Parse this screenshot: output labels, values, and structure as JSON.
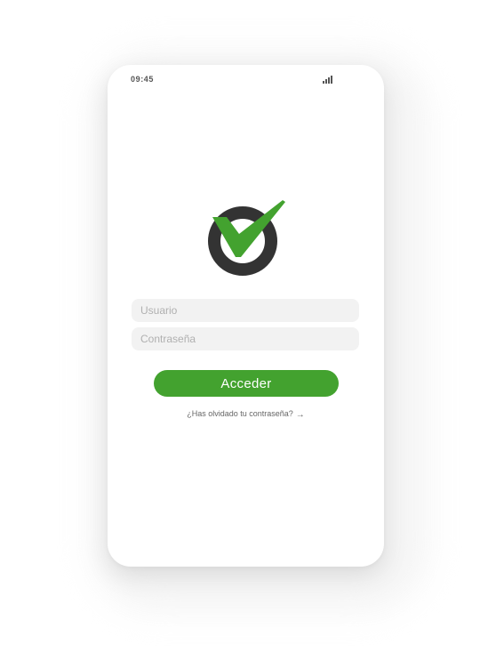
{
  "status_bar": {
    "time": "09:45",
    "signal_icon": "signal-bars-icon"
  },
  "logo": {
    "icon": "checkmark-circle-logo",
    "ring_color": "#333333",
    "check_color": "#43a22f"
  },
  "login_form": {
    "username_placeholder": "Usuario",
    "username_value": "",
    "password_placeholder": "Contraseña",
    "password_value": "",
    "submit_label": "Acceder",
    "forgot_password_text": "¿Has olvidado tu contraseña?",
    "forgot_arrow": "→"
  },
  "colors": {
    "accent": "#43a22f",
    "field_background": "#f2f2f2",
    "background": "#ffffff"
  }
}
